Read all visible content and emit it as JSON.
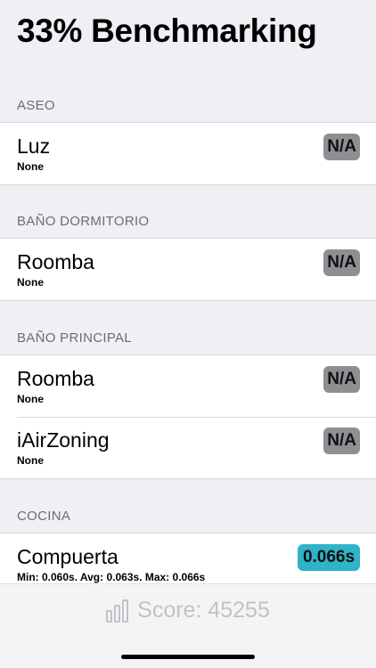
{
  "page_title": "33% Benchmarking",
  "sections": [
    {
      "header": "ASEO",
      "rows": [
        {
          "name": "Luz",
          "sub": "None",
          "badge": "N/A"
        }
      ]
    },
    {
      "header": "BAÑO DORMITORIO",
      "rows": [
        {
          "name": "Roomba",
          "sub": "None",
          "badge": "N/A"
        }
      ]
    },
    {
      "header": "BAÑO PRINCIPAL",
      "rows": [
        {
          "name": "Roomba",
          "sub": "None",
          "badge": "N/A"
        },
        {
          "name": "iAirZoning",
          "sub": "None",
          "badge": "N/A"
        }
      ]
    },
    {
      "header": "COCINA",
      "rows": [
        {
          "name": "Compuerta",
          "sub": "Min: 0.060s. Avg: 0.063s. Max: 0.066s",
          "badge": "0.066s"
        }
      ]
    }
  ],
  "footer": {
    "score_text": "Score: 45255",
    "icon": "bar-chart-icon"
  },
  "colors": {
    "na_badge": "#8e8e93",
    "time_badge": "#2fb3c8",
    "background": "#efeff4"
  }
}
